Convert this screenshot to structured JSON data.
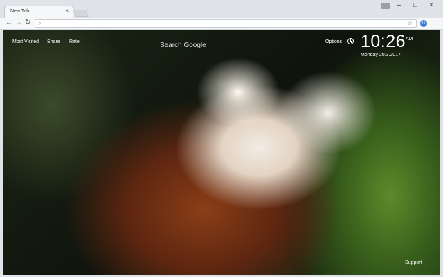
{
  "tab": {
    "title": "New Tab",
    "close": "×"
  },
  "window_controls": {
    "minimize": "–",
    "maximize": "□",
    "close": "×"
  },
  "toolbar": {
    "back": "←",
    "forward": "→",
    "reload": "↻",
    "ext_label": "G",
    "menu": "⋮"
  },
  "omnibox": {
    "search_glyph": "⌕",
    "star_glyph": "☆",
    "value": ""
  },
  "page": {
    "links": [
      "Most Visited",
      "Share",
      "Rate"
    ],
    "search_placeholder": "Search Google",
    "options": "Options",
    "time": "10:26",
    "ampm": "AM",
    "date": "Monday  20.3.2017",
    "support": "Support"
  },
  "icons": {
    "clock": "clock-icon",
    "user": "user-icon"
  }
}
